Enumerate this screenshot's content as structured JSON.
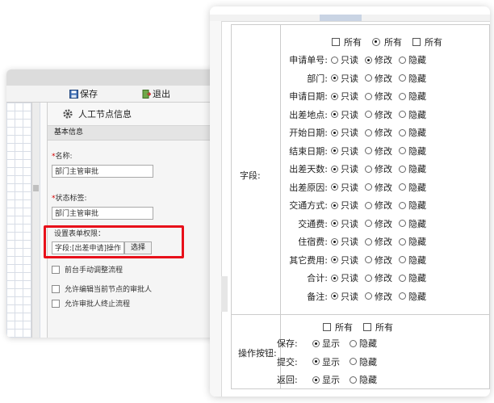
{
  "left_panel": {
    "toolbar": {
      "save_label": "保存",
      "exit_label": "退出"
    },
    "panel_title": "人工节点信息",
    "section_title": "基本信息",
    "name_label": "名称:",
    "name_value": "部门主管审批",
    "status_label": "状态标签:",
    "status_value": "部门主管审批",
    "perm_label": "设置表单权限：",
    "perm_value": "字段:[出差申请]操作",
    "select_button": "选择",
    "checkboxes": [
      "前台手动调整流程",
      "允许编辑当前节点的审批人",
      "允许审批人终止流程"
    ]
  },
  "right_panel": {
    "group_field_label": "字段:",
    "group_ops_label": "操作按钮:",
    "header_all": [
      "所有",
      "所有",
      "所有"
    ],
    "options": [
      "只读",
      "修改",
      "隐藏"
    ],
    "fields": [
      {
        "name": "申请单号:",
        "selected": 1
      },
      {
        "name": "部门:",
        "selected": 0
      },
      {
        "name": "申请日期:",
        "selected": 0
      },
      {
        "name": "出差地点:",
        "selected": 0
      },
      {
        "name": "开始日期:",
        "selected": 0
      },
      {
        "name": "结束日期:",
        "selected": 0
      },
      {
        "name": "出差天数:",
        "selected": 0
      },
      {
        "name": "出差原因:",
        "selected": 0
      },
      {
        "name": "交通方式:",
        "selected": 0
      },
      {
        "name": "交通费:",
        "selected": 0
      },
      {
        "name": "住宿费:",
        "selected": 0
      },
      {
        "name": "其它费用:",
        "selected": 0
      },
      {
        "name": "合计:",
        "selected": 0
      },
      {
        "name": "备注:",
        "selected": 0
      }
    ],
    "ops_header_all": [
      "所有",
      "所有"
    ],
    "ops_options": [
      "显示",
      "隐藏"
    ],
    "ops": [
      {
        "name": "保存:",
        "selected": 0
      },
      {
        "name": "提交:",
        "selected": 0
      },
      {
        "name": "返回:",
        "selected": 0
      }
    ]
  }
}
